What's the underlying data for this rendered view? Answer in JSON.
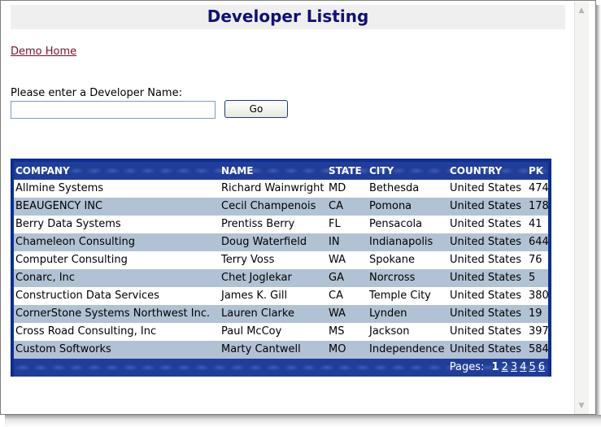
{
  "title": "Developer Listing",
  "demo_link": "Demo Home",
  "search": {
    "prompt": "Please enter a Developer Name:",
    "value": "",
    "button_label": "Go"
  },
  "grid": {
    "columns": [
      "COMPANY",
      "NAME",
      "STATE",
      "CITY",
      "COUNTRY",
      "PK"
    ],
    "rows": [
      [
        "Allmine Systems",
        "Richard Wainwright",
        "MD",
        "Bethesda",
        "United States",
        "474"
      ],
      [
        "BEAUGENCY INC",
        "Cecil Champenois",
        "CA",
        "Pomona",
        "United States",
        "178"
      ],
      [
        "Berry Data Systems",
        "Prentiss Berry",
        "FL",
        "Pensacola",
        "United States",
        "41"
      ],
      [
        "Chameleon Consulting",
        "Doug Waterfield",
        "IN",
        "Indianapolis",
        "United States",
        "644"
      ],
      [
        "Computer Consulting",
        "Terry Voss",
        "WA",
        "Spokane",
        "United States",
        "76"
      ],
      [
        "Conarc, Inc",
        "Chet Joglekar",
        "GA",
        "Norcross",
        "United States",
        "5"
      ],
      [
        "Construction Data Services",
        "James K. Gill",
        "CA",
        "Temple City",
        "United States",
        "380"
      ],
      [
        "CornerStone Systems Northwest Inc.",
        "Lauren Clarke",
        "WA",
        "Lynden",
        "United States",
        "19"
      ],
      [
        "Cross Road Consulting, Inc",
        "Paul McCoy",
        "MS",
        "Jackson",
        "United States",
        "397"
      ],
      [
        "Custom Softworks",
        "Marty Cantwell",
        "MO",
        "Independence",
        "United States",
        "584"
      ]
    ],
    "pager": {
      "label": "Pages:",
      "pages": [
        "1",
        "2",
        "3",
        "4",
        "5",
        "6"
      ],
      "current": "1"
    }
  },
  "colors": {
    "title_text": "#101075",
    "grid_header_bg": "#1f3d99",
    "row_alt_bg": "#b1c2d4",
    "link": "#7a0f2a"
  },
  "icons": {
    "scroll_up": "scroll-up-arrow-icon",
    "scroll_down": "scroll-down-arrow-icon"
  }
}
